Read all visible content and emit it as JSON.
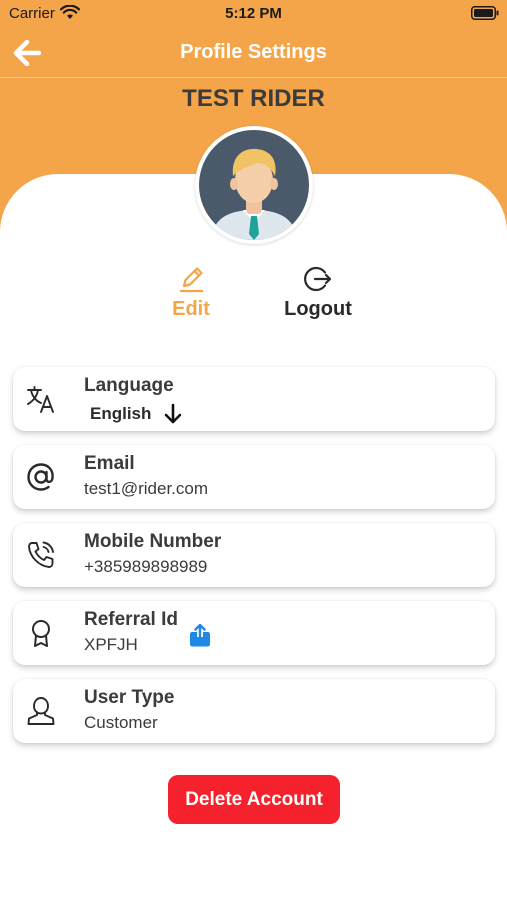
{
  "status_bar": {
    "carrier": "Carrier",
    "time": "5:12 PM"
  },
  "header": {
    "title": "Profile Settings",
    "back_icon": "arrow-left-icon"
  },
  "profile": {
    "name": "TEST RIDER"
  },
  "actions": {
    "edit_label": "Edit",
    "logout_label": "Logout"
  },
  "fields": {
    "language": {
      "title": "Language",
      "value": "English"
    },
    "email": {
      "title": "Email",
      "value": "test1@rider.com"
    },
    "mobile": {
      "title": "Mobile Number",
      "value": "+385989898989"
    },
    "referral": {
      "title": "Referral Id",
      "value": "XPFJH"
    },
    "user_type": {
      "title": "User Type",
      "value": "Customer"
    }
  },
  "delete_button": {
    "label": "Delete Account"
  },
  "colors": {
    "accent": "#F4A54A",
    "danger": "#F5222D",
    "share": "#1E88E5"
  }
}
